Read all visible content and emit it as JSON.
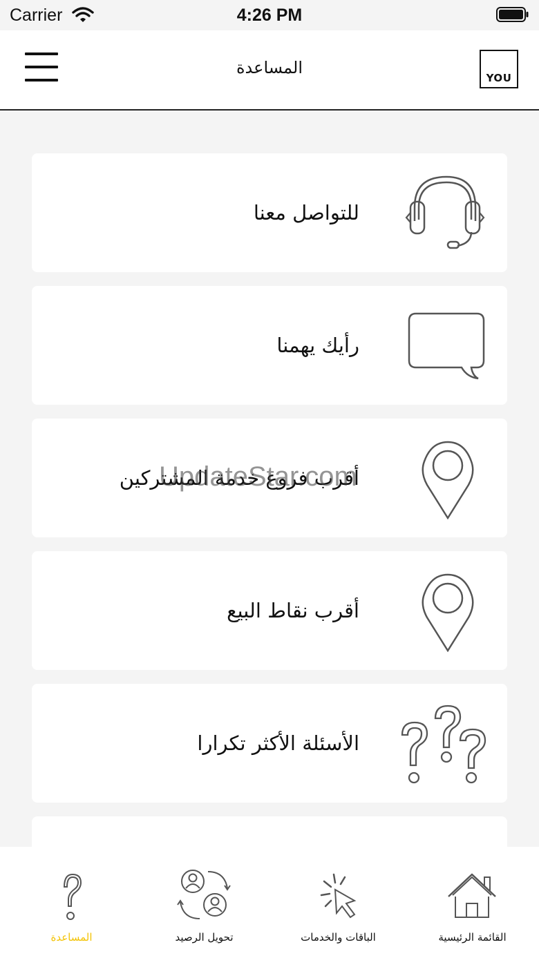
{
  "status_bar": {
    "carrier": "Carrier",
    "time": "4:26 PM"
  },
  "header": {
    "title": "المساعدة",
    "logo_text": "YOU",
    "menu_icon": "hamburger-menu-icon"
  },
  "menu_items": [
    {
      "label": "للتواصل معنا",
      "icon": "headset-icon"
    },
    {
      "label": "رأيك يهمنا",
      "icon": "speech-bubble-icon"
    },
    {
      "label": "أقرب فروع خدمة المشتركين",
      "icon": "location-pin-icon"
    },
    {
      "label": "أقرب نقاط البيع",
      "icon": "location-pin-icon"
    },
    {
      "label": "الأسئلة الأكثر تكرارا",
      "icon": "question-marks-icon"
    }
  ],
  "watermark": "UpdateStar.com",
  "tab_bar": {
    "active_color": "#f3c200",
    "tabs": [
      {
        "label": "المساعدة",
        "icon": "help-question-icon",
        "active": true
      },
      {
        "label": "تحويل الرصيد",
        "icon": "balance-transfer-icon",
        "active": false
      },
      {
        "label": "الباقات والخدمات",
        "icon": "click-pointer-icon",
        "active": false
      },
      {
        "label": "القائمة الرئيسية",
        "icon": "home-icon",
        "active": false
      }
    ]
  }
}
